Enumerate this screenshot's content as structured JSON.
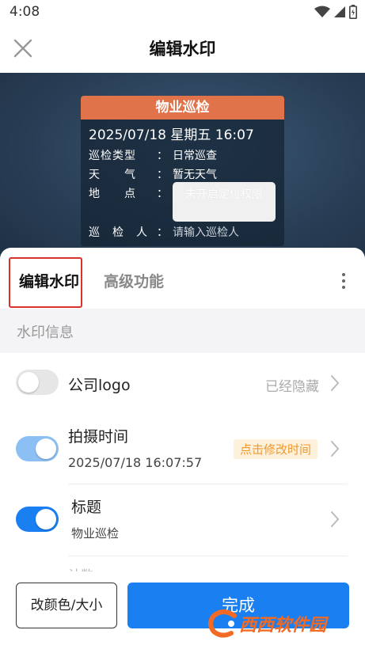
{
  "status_bar": {
    "time": "4:08",
    "icons": [
      "wifi-icon",
      "signal-icon",
      "battery-icon"
    ]
  },
  "app_bar": {
    "title": "编辑水印",
    "close_icon": "close-icon"
  },
  "watermark": {
    "header": "物业巡检",
    "header_color": "#e0734a",
    "datetime": "2025/07/18 星期五 16:07",
    "rows": [
      {
        "label": "巡检类型",
        "colon": "：",
        "value": "日常巡查"
      },
      {
        "label": "天　　气",
        "colon": "：",
        "value": "暂无天气"
      },
      {
        "label": "地　　点",
        "colon": "：",
        "value": ""
      },
      {
        "label": "巡　检　人",
        "colon": "：",
        "value": "请输入巡检人"
      }
    ],
    "location_notice": "未开启定位权限"
  },
  "tabs": {
    "edit": "编辑水印",
    "advanced": "高级功能",
    "more_icon": "more-vertical-icon"
  },
  "section": {
    "title": "水印信息"
  },
  "items": [
    {
      "title": "公司logo",
      "toggle": "off",
      "status": "已经隐藏"
    },
    {
      "title": "拍摄时间",
      "toggle": "on",
      "subtitle": "2025/07/18 16:07:57",
      "badge": "点击修改时间"
    },
    {
      "title": "标题",
      "toggle": "on",
      "subtitle": "物业巡检"
    }
  ],
  "partial_item": "计数",
  "buttons": {
    "color_size": "改颜色/大小",
    "done": "完成"
  },
  "site_logo": {
    "brand": "西西软件园",
    "url": "CR173.COM"
  },
  "colors": {
    "accent": "#1a7ff0",
    "highlight_border": "#d9322b",
    "badge_text": "#f09a2c"
  }
}
